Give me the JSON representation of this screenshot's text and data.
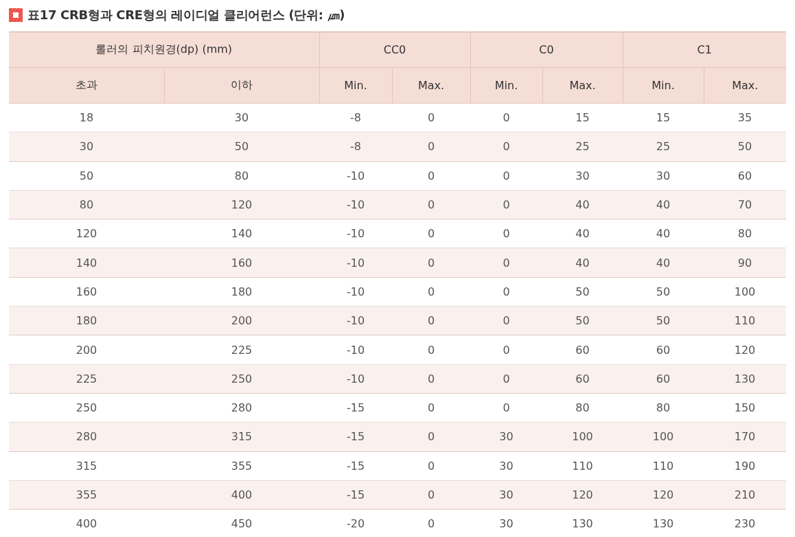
{
  "title": "표17 CRB형과 CRE형의 레이디얼 클리어런스 (단위: ㎛)",
  "table": {
    "group_headers": [
      "롤러의 피치원경(dp) (mm)",
      "CC0",
      "C0",
      "C1"
    ],
    "sub_headers": [
      "초과",
      "이하",
      "Min.",
      "Max.",
      "Min.",
      "Max.",
      "Min.",
      "Max."
    ],
    "rows": [
      [
        "18",
        "30",
        "-8",
        "0",
        "0",
        "15",
        "15",
        "35"
      ],
      [
        "30",
        "50",
        "-8",
        "0",
        "0",
        "25",
        "25",
        "50"
      ],
      [
        "50",
        "80",
        "-10",
        "0",
        "0",
        "30",
        "30",
        "60"
      ],
      [
        "80",
        "120",
        "-10",
        "0",
        "0",
        "40",
        "40",
        "70"
      ],
      [
        "120",
        "140",
        "-10",
        "0",
        "0",
        "40",
        "40",
        "80"
      ],
      [
        "140",
        "160",
        "-10",
        "0",
        "0",
        "40",
        "40",
        "90"
      ],
      [
        "160",
        "180",
        "-10",
        "0",
        "0",
        "50",
        "50",
        "100"
      ],
      [
        "180",
        "200",
        "-10",
        "0",
        "0",
        "50",
        "50",
        "110"
      ],
      [
        "200",
        "225",
        "-10",
        "0",
        "0",
        "60",
        "60",
        "120"
      ],
      [
        "225",
        "250",
        "-10",
        "0",
        "0",
        "60",
        "60",
        "130"
      ],
      [
        "250",
        "280",
        "-15",
        "0",
        "0",
        "80",
        "80",
        "150"
      ],
      [
        "280",
        "315",
        "-15",
        "0",
        "30",
        "100",
        "100",
        "170"
      ],
      [
        "315",
        "355",
        "-15",
        "0",
        "30",
        "110",
        "110",
        "190"
      ],
      [
        "355",
        "400",
        "-15",
        "0",
        "30",
        "120",
        "120",
        "210"
      ],
      [
        "400",
        "450",
        "-20",
        "0",
        "30",
        "130",
        "130",
        "230"
      ]
    ]
  }
}
